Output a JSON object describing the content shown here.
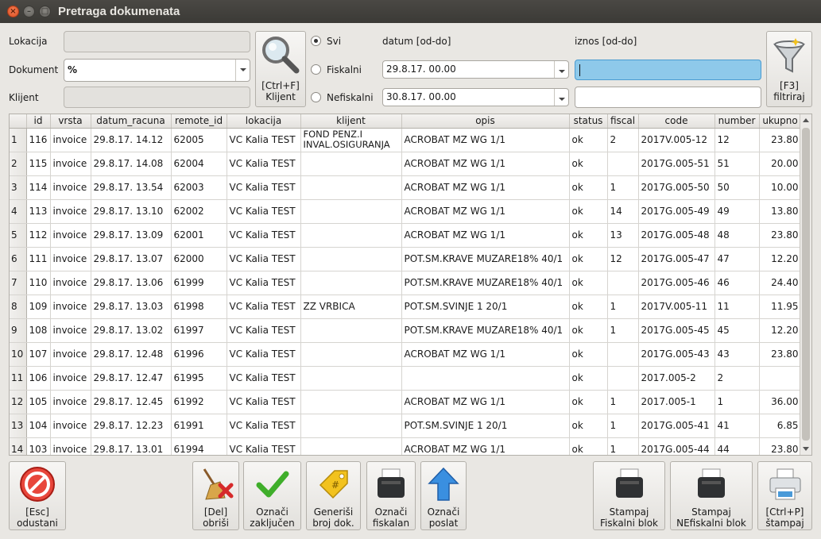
{
  "window": {
    "title": "Pretraga dokumenata"
  },
  "filters": {
    "lokacija_label": "Lokacija",
    "dokument_label": "Dokument",
    "dokument_value": "%",
    "klijent_label": "Klijent",
    "client_button": "[Ctrl+F]\nKlijent",
    "radio_svi": "Svi",
    "radio_fiskalni": "Fiskalni",
    "radio_nefiskalni": "Nefiskalni",
    "datum_label": "datum [od-do]",
    "datum_od": "29.8.17. 00.00",
    "datum_do": "30.8.17. 00.00",
    "iznos_label": "iznos [od-do]",
    "filter_button": "[F3]\nfiltriraj"
  },
  "table": {
    "columns": [
      "id",
      "vrsta",
      "datum_racuna",
      "remote_id",
      "lokacija",
      "klijent",
      "opis",
      "status",
      "fiscal",
      "code",
      "number",
      "ukupno"
    ],
    "rows": [
      [
        "1",
        "116",
        "invoice",
        "29.8.17. 14.12",
        "62005",
        "VC Kalia TEST",
        "FOND PENZ.I INVAL.OSIGURANJA",
        "ACROBAT MZ WG 1/1",
        "ok",
        "2",
        "2017V.005-12",
        "12",
        "23.80"
      ],
      [
        "2",
        "115",
        "invoice",
        "29.8.17. 14.08",
        "62004",
        "VC Kalia TEST",
        "",
        "ACROBAT MZ WG 1/1",
        "ok",
        "",
        "2017G.005-51",
        "51",
        "20.00"
      ],
      [
        "3",
        "114",
        "invoice",
        "29.8.17. 13.54",
        "62003",
        "VC Kalia TEST",
        "",
        "ACROBAT MZ WG 1/1",
        "ok",
        "1",
        "2017G.005-50",
        "50",
        "10.00"
      ],
      [
        "4",
        "113",
        "invoice",
        "29.8.17. 13.10",
        "62002",
        "VC Kalia TEST",
        "",
        "ACROBAT MZ WG 1/1",
        "ok",
        "14",
        "2017G.005-49",
        "49",
        "13.80"
      ],
      [
        "5",
        "112",
        "invoice",
        "29.8.17. 13.09",
        "62001",
        "VC Kalia TEST",
        "",
        "ACROBAT MZ WG 1/1",
        "ok",
        "13",
        "2017G.005-48",
        "48",
        "23.80"
      ],
      [
        "6",
        "111",
        "invoice",
        "29.8.17. 13.07",
        "62000",
        "VC Kalia TEST",
        "",
        "POT.SM.KRAVE MUZARE18% 40/1",
        "ok",
        "12",
        "2017G.005-47",
        "47",
        "12.20"
      ],
      [
        "7",
        "110",
        "invoice",
        "29.8.17. 13.06",
        "61999",
        "VC Kalia TEST",
        "",
        "POT.SM.KRAVE MUZARE18% 40/1",
        "ok",
        "",
        "2017G.005-46",
        "46",
        "24.40"
      ],
      [
        "8",
        "109",
        "invoice",
        "29.8.17. 13.03",
        "61998",
        "VC Kalia TEST",
        "ZZ VRBICA",
        "POT.SM.SVINJE 1 20/1",
        "ok",
        "1",
        "2017V.005-11",
        "11",
        "11.95"
      ],
      [
        "9",
        "108",
        "invoice",
        "29.8.17. 13.02",
        "61997",
        "VC Kalia TEST",
        "",
        "POT.SM.KRAVE MUZARE18% 40/1",
        "ok",
        "1",
        "2017G.005-45",
        "45",
        "12.20"
      ],
      [
        "10",
        "107",
        "invoice",
        "29.8.17. 12.48",
        "61996",
        "VC Kalia TEST",
        "",
        "ACROBAT MZ WG 1/1",
        "ok",
        "",
        "2017G.005-43",
        "43",
        "23.80"
      ],
      [
        "11",
        "106",
        "invoice",
        "29.8.17. 12.47",
        "61995",
        "VC Kalia TEST",
        "",
        "",
        "ok",
        "",
        "2017.005-2",
        "2",
        ""
      ],
      [
        "12",
        "105",
        "invoice",
        "29.8.17. 12.45",
        "61992",
        "VC Kalia TEST",
        "",
        "ACROBAT MZ WG 1/1",
        "ok",
        "1",
        "2017.005-1",
        "1",
        "36.00"
      ],
      [
        "13",
        "104",
        "invoice",
        "29.8.17. 12.23",
        "61991",
        "VC Kalia TEST",
        "",
        "POT.SM.SVINJE 1 20/1",
        "ok",
        "1",
        "2017G.005-41",
        "41",
        "6.85"
      ],
      [
        "14",
        "103",
        "invoice",
        "29.8.17. 13.01",
        "61994",
        "VC Kalia TEST",
        "",
        "ACROBAT MZ WG 1/1",
        "ok",
        "1",
        "2017G.005-44",
        "44",
        "23.80"
      ]
    ]
  },
  "buttons": {
    "cancel": "[Esc]\nodustani",
    "delete": "[Del]\nobriši",
    "mark_closed": "Označi\nzaključen",
    "generate": "Generiši\nbroj dok.",
    "mark_fiscal": "Označi\nfiskalan",
    "mark_sent": "Označi\nposlat",
    "print_fiscal": "Stampaj\nFiskalni blok",
    "print_nonfiscal": "Stampaj\nNEfiskalni blok",
    "print": "[Ctrl+P]\nštampaj"
  },
  "icons": {
    "search": "magnifier-icon",
    "filter": "funnel-icon",
    "cancel": "no-entry-icon",
    "delete": "broom-delete-icon",
    "mark_closed": "checkmark-icon",
    "generate": "tag-icon",
    "mark_fiscal": "receipt-printer-icon",
    "mark_sent": "arrow-up-icon",
    "print_fiscal": "receipt-printer-icon",
    "print_nonfiscal": "receipt-printer-icon",
    "print": "printer-icon"
  },
  "colors": {
    "active_input": "#8ec9ea",
    "titlebar": "#3e3d39",
    "close_button": "#e85e2f"
  }
}
